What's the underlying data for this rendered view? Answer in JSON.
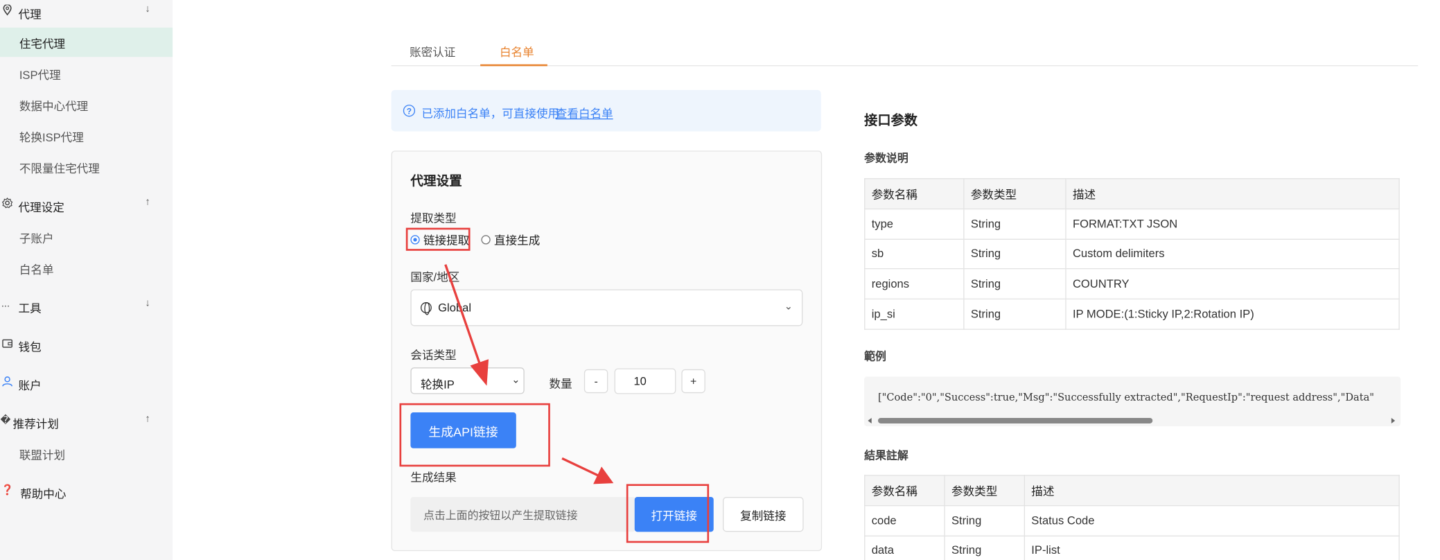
{
  "sidebar": {
    "groups": [
      {
        "icon": "location-pin-icon",
        "label": "代理",
        "chevron": "↓"
      },
      {
        "icon": "gear-icon",
        "label": "代理设定",
        "chevron": "↑"
      },
      {
        "icon": "ellipsis-icon",
        "icon_glyph": "...",
        "label": "工具",
        "chevron": "↓"
      },
      {
        "icon": "wallet-icon",
        "label": "钱包",
        "chevron": ""
      },
      {
        "icon": "user-icon",
        "label": "账户",
        "chevron": ""
      },
      {
        "icon": "unknown-glyph-icon",
        "icon_glyph": "�",
        "label": "推荐计划",
        "chevron": "↑"
      },
      {
        "icon": "help-icon",
        "icon_glyph": "❓",
        "label": "帮助中心",
        "chevron": ""
      }
    ],
    "items": [
      "住宅代理",
      "ISP代理",
      "数据中心代理",
      "轮换ISP代理",
      "不限量住宅代理",
      "子账户",
      "白名单",
      "联盟计划"
    ],
    "active_item": "住宅代理"
  },
  "tabs": [
    "账密认证",
    "白名单"
  ],
  "active_tab": "白名单",
  "notice": {
    "text": "已添加白名单，可直接使用",
    "link": "查看白名单"
  },
  "proxy_settings": {
    "title": "代理设置",
    "extract_type_label": "提取类型",
    "extract_options": [
      "链接提取",
      "直接生成"
    ],
    "extract_selected": "链接提取",
    "country_label": "国家/地区",
    "country_value": "Global",
    "session_label": "会话类型",
    "session_value": "轮换IP",
    "quantity_label": "数量",
    "quantity_value": "10",
    "minus": "-",
    "plus": "+",
    "generate_button": "生成API链接",
    "result_label": "生成结果",
    "result_placeholder": "点击上面的按钮以产生提取链接",
    "open_button": "打开链接",
    "copy_button": "复制链接"
  },
  "api_params": {
    "title": "接口参数",
    "param_desc_title": "参数说明",
    "headers": [
      "参数名稱",
      "参数类型",
      "描述"
    ],
    "rows": [
      [
        "type",
        "String",
        "FORMAT:TXT JSON"
      ],
      [
        "sb",
        "String",
        "Custom delimiters"
      ],
      [
        "regions",
        "String",
        "COUNTRY"
      ],
      [
        "ip_si",
        "String",
        "IP MODE:(1:Sticky IP,2:Rotation IP)"
      ]
    ],
    "example_title": "範例",
    "example_code": "[\"Code\":\"0\",\"Success\":true,\"Msg\":\"Successfully extracted\",\"RequestIp\":\"request address\",\"Data\"",
    "result_title": "結果註解",
    "result_headers": [
      "参数名稱",
      "参数类型",
      "描述"
    ],
    "result_rows": [
      [
        "code",
        "String",
        "Status Code"
      ],
      [
        "data",
        "String",
        "IP-list"
      ]
    ]
  },
  "colors": {
    "accent_blue": "#3b82f6",
    "tab_active": "#e8832f",
    "annotation_red": "#e8403e",
    "active_nav_bg": "#dff0ea"
  }
}
